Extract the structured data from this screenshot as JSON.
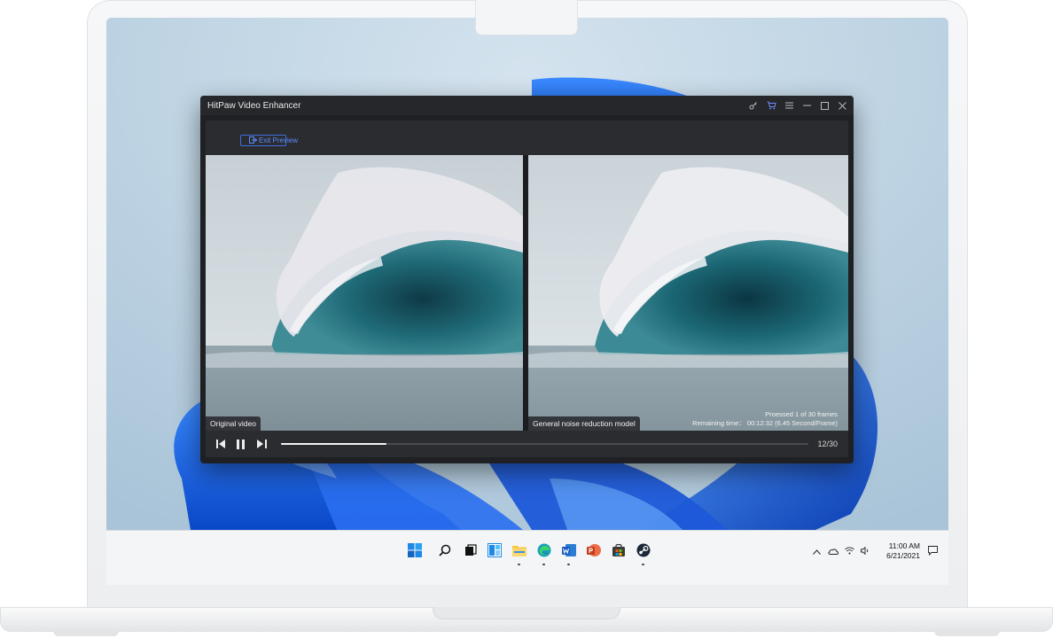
{
  "app": {
    "title": "HitPaw Video Enhancer",
    "window_controls": [
      "key-icon",
      "cart-icon",
      "menu-icon",
      "minimize-icon",
      "maximize-icon",
      "close-icon"
    ]
  },
  "preview": {
    "exit_label": "Exit Preview",
    "left_label": "Original video",
    "right_label": "General noise reduction model",
    "processed_text": "Proessed 1 of 30 frames",
    "remaining_text": "Remaining time： 00:12:32 (6.45 Second/Frame)"
  },
  "playback": {
    "progress_fraction": 0.2,
    "frame_counter": "12/30"
  },
  "taskbar": {
    "apps": [
      "windows-start-icon",
      "search-icon",
      "task-view-icon",
      "widgets-icon",
      "file-explorer-icon",
      "edge-icon",
      "word-icon",
      "powerpoint-icon",
      "store-icon",
      "steam-icon"
    ],
    "time": "11:00 AM",
    "date": "6/21/2021"
  },
  "colors": {
    "accent": "#3e6fe0",
    "window_bg": "#1f2023",
    "wallpaper": "#bcd3e3",
    "bloom_blue": "#1f6fe8"
  }
}
